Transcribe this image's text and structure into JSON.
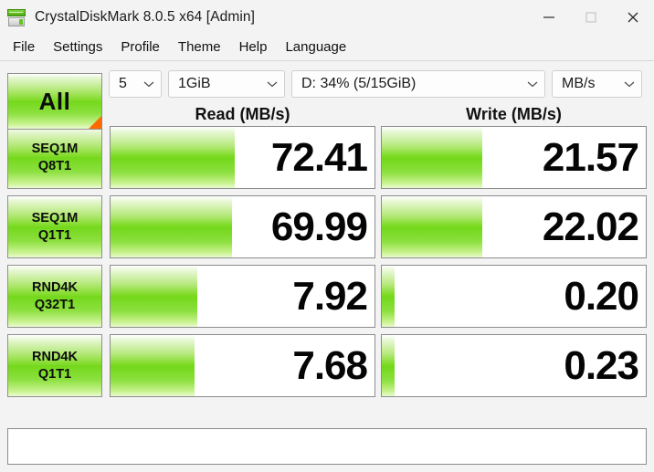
{
  "window": {
    "title": "CrystalDiskMark 8.0.5 x64 [Admin]",
    "icon": "crystaldiskmark-icon",
    "minimize_label": "—",
    "maximize_label": "□",
    "close_label": "✕"
  },
  "menu": {
    "items": [
      {
        "label": "File"
      },
      {
        "label": "Settings"
      },
      {
        "label": "Profile"
      },
      {
        "label": "Theme"
      },
      {
        "label": "Help"
      },
      {
        "label": "Language"
      }
    ]
  },
  "toolbar": {
    "all_button": "All",
    "test_count": "5",
    "test_size": "1GiB",
    "drive": "D: 34% (5/15GiB)",
    "unit": "MB/s"
  },
  "columns": {
    "read": "Read (MB/s)",
    "write": "Write (MB/s)"
  },
  "chart_data": {
    "type": "bar",
    "title": "CrystalDiskMark 8.0.5 benchmark results",
    "unit": "MB/s",
    "categories": [
      "SEQ1M Q8T1",
      "SEQ1M Q1T1",
      "RND4K Q32T1",
      "RND4K Q1T1"
    ],
    "series": [
      {
        "name": "Read (MB/s)",
        "values": [
          72.41,
          69.99,
          7.92,
          7.68
        ]
      },
      {
        "name": "Write (MB/s)",
        "values": [
          21.57,
          22.02,
          0.2,
          0.23
        ]
      }
    ]
  },
  "rows": [
    {
      "label_top": "SEQ1M",
      "label_bottom": "Q8T1",
      "read": {
        "value": "72.41",
        "fill_pct": 47
      },
      "write": {
        "value": "21.57",
        "fill_pct": 38
      }
    },
    {
      "label_top": "SEQ1M",
      "label_bottom": "Q1T1",
      "read": {
        "value": "69.99",
        "fill_pct": 46
      },
      "write": {
        "value": "22.02",
        "fill_pct": 38
      }
    },
    {
      "label_top": "RND4K",
      "label_bottom": "Q32T1",
      "read": {
        "value": "7.92",
        "fill_pct": 33
      },
      "write": {
        "value": "0.20",
        "fill_pct": 5
      }
    },
    {
      "label_top": "RND4K",
      "label_bottom": "Q1T1",
      "read": {
        "value": "7.68",
        "fill_pct": 32
      },
      "write": {
        "value": "0.23",
        "fill_pct": 5
      }
    }
  ],
  "status": {
    "text": ""
  },
  "colors": {
    "accent_green": "#74d81b",
    "accent_orange": "#ff6a00",
    "window_bg": "#f3f3f3"
  }
}
